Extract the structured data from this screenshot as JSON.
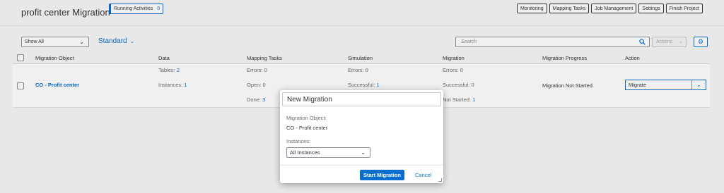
{
  "header": {
    "title": "profit center Migration",
    "running_label": "Running Activities",
    "running_count": "0",
    "buttons": [
      "Monitoring",
      "Mapping Tasks",
      "Job Management",
      "Settings",
      "Finish Project"
    ]
  },
  "toolbar": {
    "filter_value": "Show All",
    "variant": "Standard",
    "search_placeholder": "Search",
    "actions_label": "Actions"
  },
  "table": {
    "columns": [
      "Migration Object",
      "Data",
      "Mapping Tasks",
      "Simulation",
      "Migration",
      "Migration Progress",
      "Action"
    ],
    "row": {
      "object": "CO - Profit center",
      "tables_label": "Tables:",
      "tables_value": "2",
      "instances_label": "Instances:",
      "instances_value": "1",
      "map_errors_label": "Errors:",
      "map_errors_value": "0",
      "map_open_label": "Open:",
      "map_open_value": "0",
      "map_done_label": "Done:",
      "map_done_value": "3",
      "sim_errors_label": "Errors:",
      "sim_errors_value": "0",
      "sim_success_label": "Successful:",
      "sim_success_value": "1",
      "mig_errors_label": "Errors:",
      "mig_errors_value": "0",
      "mig_success_label": "Successful:",
      "mig_success_value": "0",
      "mig_notstarted_label": "Not Started:",
      "mig_notstarted_value": "1",
      "progress": "Migration Not Started",
      "action": "Migrate"
    }
  },
  "dialog": {
    "title": "New Migration",
    "object_label": "Migration Object:",
    "object_value": "CO - Profit center",
    "instances_label": "Instances:",
    "instances_value": "All Instances",
    "primary_button": "Start Migration",
    "cancel_button": "Cancel"
  },
  "colors": {
    "accent": "#0a6ed1",
    "background": "#f7f7f7",
    "text": "#32363a"
  }
}
